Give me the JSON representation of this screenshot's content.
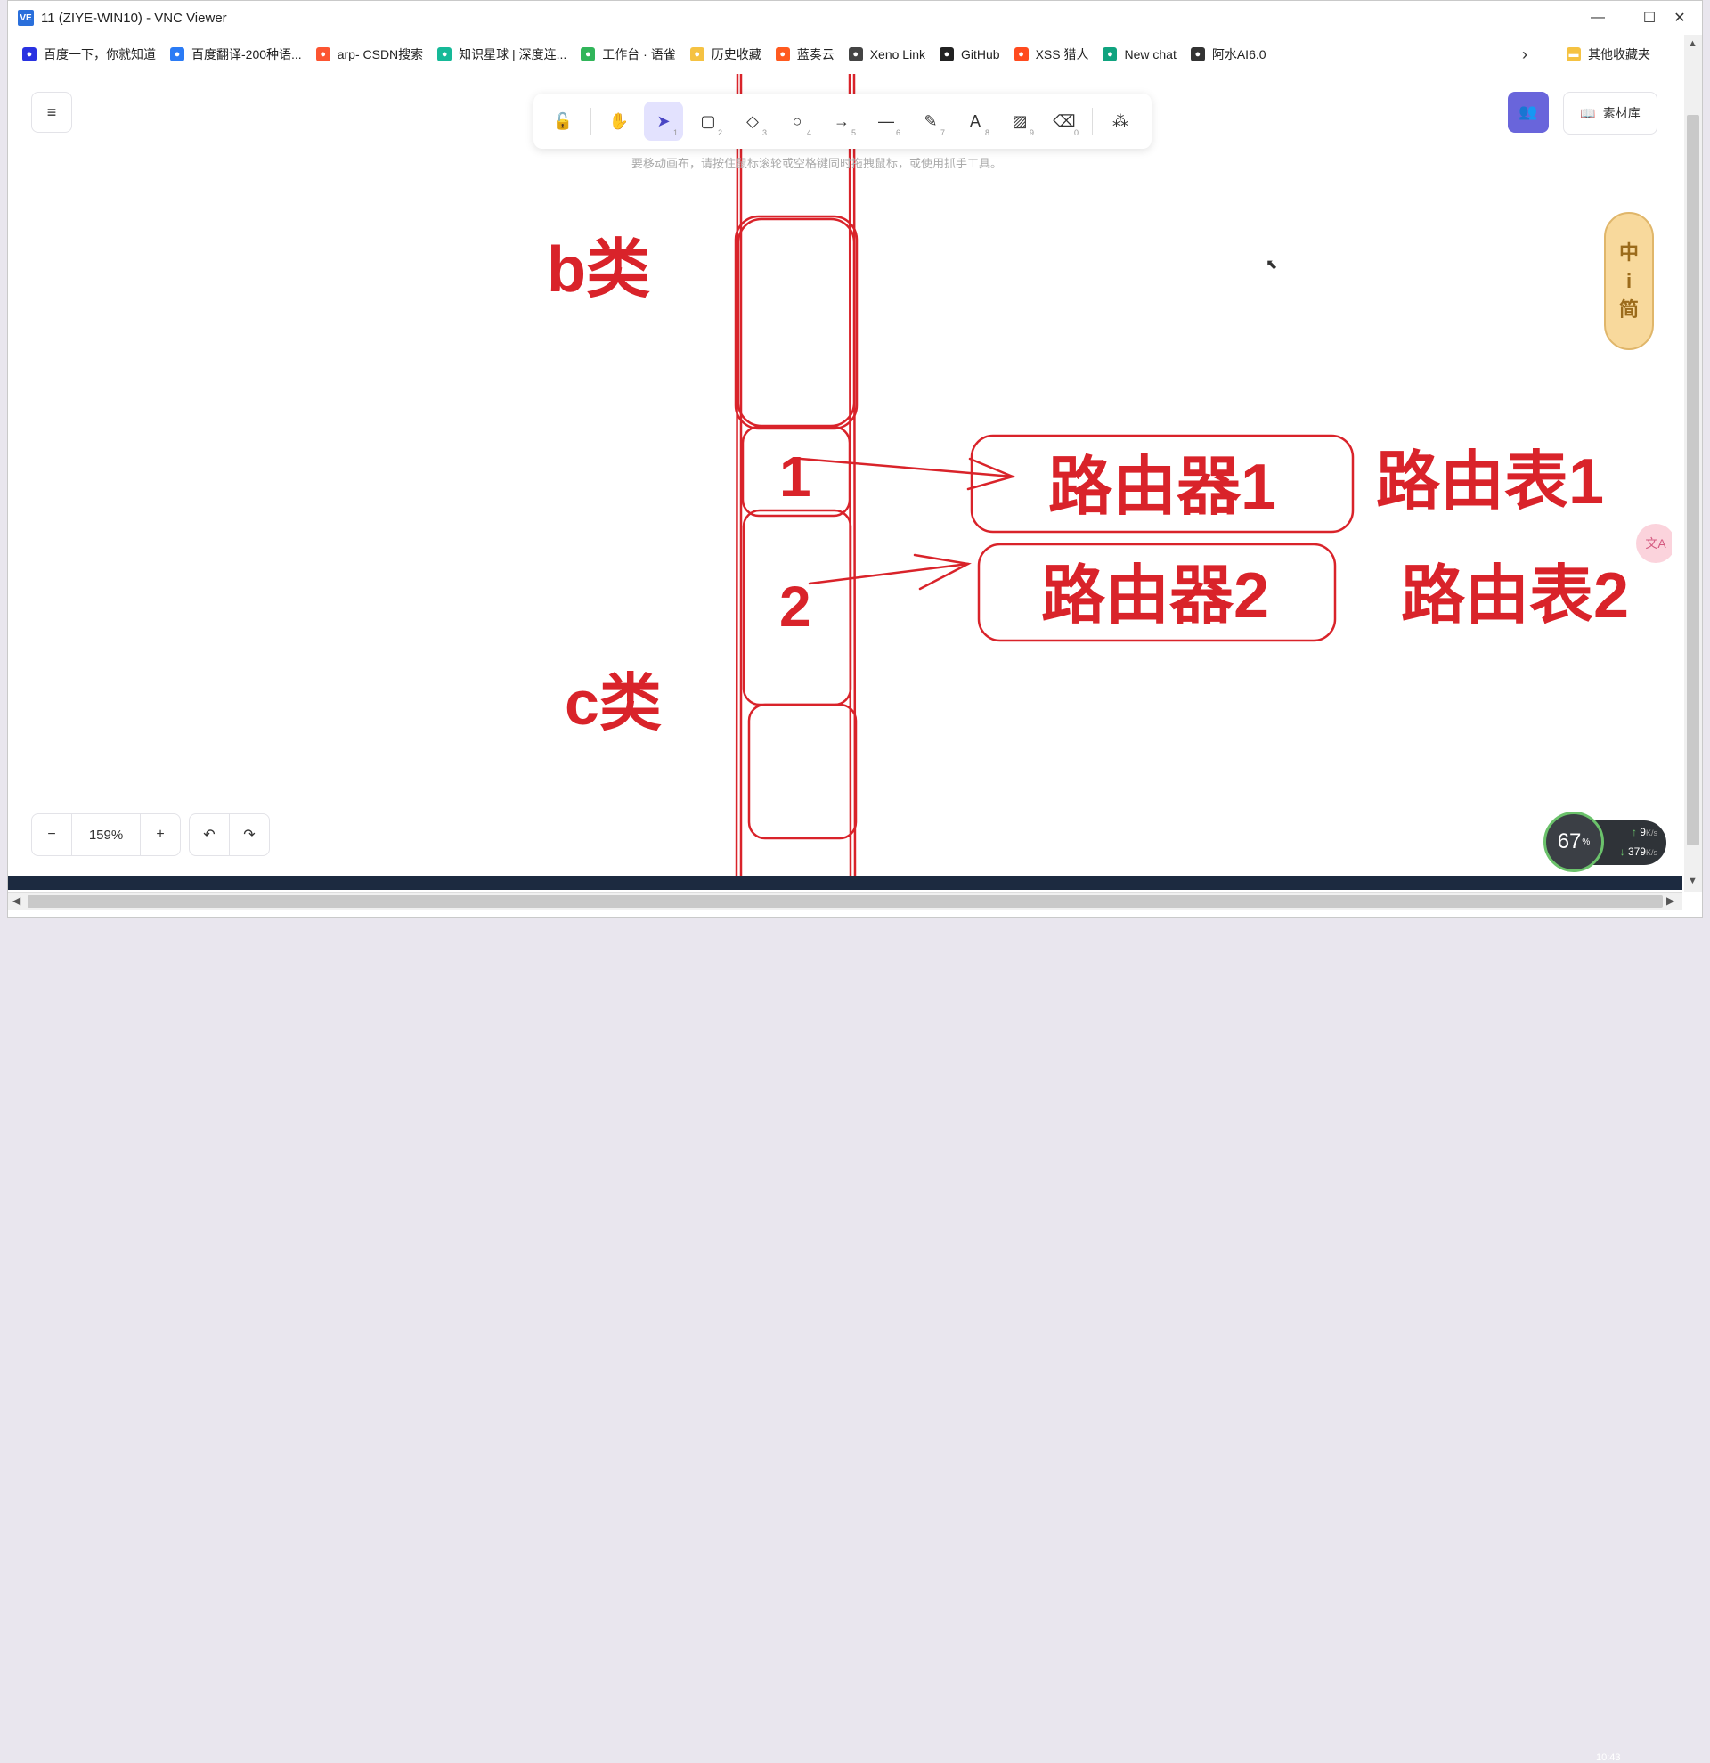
{
  "window": {
    "title": "11 (ZIYE-WIN10) - VNC Viewer",
    "logo": "VE"
  },
  "bookmarks": [
    {
      "label": "百度一下，你就知道",
      "icon": "baidu-icon",
      "color": "#2932e1"
    },
    {
      "label": "百度翻译-200种语...",
      "icon": "translate-icon",
      "color": "#2b7bf5"
    },
    {
      "label": "arp- CSDN搜索",
      "icon": "csdn-icon",
      "color": "#fc5531"
    },
    {
      "label": "知识星球 | 深度连...",
      "icon": "zsxq-icon",
      "color": "#16b998"
    },
    {
      "label": "工作台 · 语雀",
      "icon": "yuque-icon",
      "color": "#31b55a"
    },
    {
      "label": "历史收藏",
      "icon": "folder-icon",
      "color": "#f5c242"
    },
    {
      "label": "蓝奏云",
      "icon": "lanzou-icon",
      "color": "#ff5a1f"
    },
    {
      "label": "Xeno Link",
      "icon": "file-icon",
      "color": "#444444"
    },
    {
      "label": "GitHub",
      "icon": "github-icon",
      "color": "#222222"
    },
    {
      "label": "XSS 猎人",
      "icon": "fire-icon",
      "color": "#ff4b1f"
    },
    {
      "label": "New chat",
      "icon": "openai-icon",
      "color": "#10a37f"
    },
    {
      "label": "阿水AI6.0",
      "icon": "bot-icon",
      "color": "#333333"
    }
  ],
  "bookmarks_more": "›",
  "other_bookmarks": "其他收藏夹",
  "toolbar": {
    "tools": [
      {
        "name": "lock-tool",
        "glyph": "🔓",
        "key": ""
      },
      {
        "name": "hand-tool",
        "glyph": "✋",
        "key": ""
      },
      {
        "name": "select-tool",
        "glyph": "➤",
        "key": "1"
      },
      {
        "name": "rectangle-tool",
        "glyph": "▢",
        "key": "2"
      },
      {
        "name": "diamond-tool",
        "glyph": "◇",
        "key": "3"
      },
      {
        "name": "ellipse-tool",
        "glyph": "○",
        "key": "4"
      },
      {
        "name": "arrow-tool",
        "glyph": "→",
        "key": "5"
      },
      {
        "name": "line-tool",
        "glyph": "—",
        "key": "6"
      },
      {
        "name": "pencil-tool",
        "glyph": "✎",
        "key": "7"
      },
      {
        "name": "text-tool",
        "glyph": "A",
        "key": "8"
      },
      {
        "name": "image-tool",
        "glyph": "▨",
        "key": "9"
      },
      {
        "name": "eraser-tool",
        "glyph": "⌫",
        "key": "0"
      },
      {
        "name": "shapes-tool",
        "glyph": "⁂",
        "key": ""
      }
    ],
    "active": "select-tool"
  },
  "hint": "要移动画布，请按住鼠标滚轮或空格键同时拖拽鼠标，或使用抓手工具。",
  "library_label": "素材库",
  "ime": {
    "chars": [
      "中",
      "i",
      "简"
    ]
  },
  "translate_label": "文A",
  "zoom": {
    "value": "159%",
    "minus": "−",
    "plus": "+"
  },
  "undo": "↶",
  "redo": "↷",
  "sketch": {
    "b_class": "b类",
    "c_class": "c类",
    "seg1": "1",
    "seg2": "2",
    "router1": "路由器1",
    "router2": "路由器2",
    "table1": "路由表1",
    "table2": "路由表2",
    "stroke_color": "#d9232a"
  },
  "speed": {
    "percent": "67",
    "unit": "%",
    "up": "9",
    "up_unit": "K/s",
    "down": "379",
    "down_unit": "K/s"
  },
  "clock": "10:43"
}
